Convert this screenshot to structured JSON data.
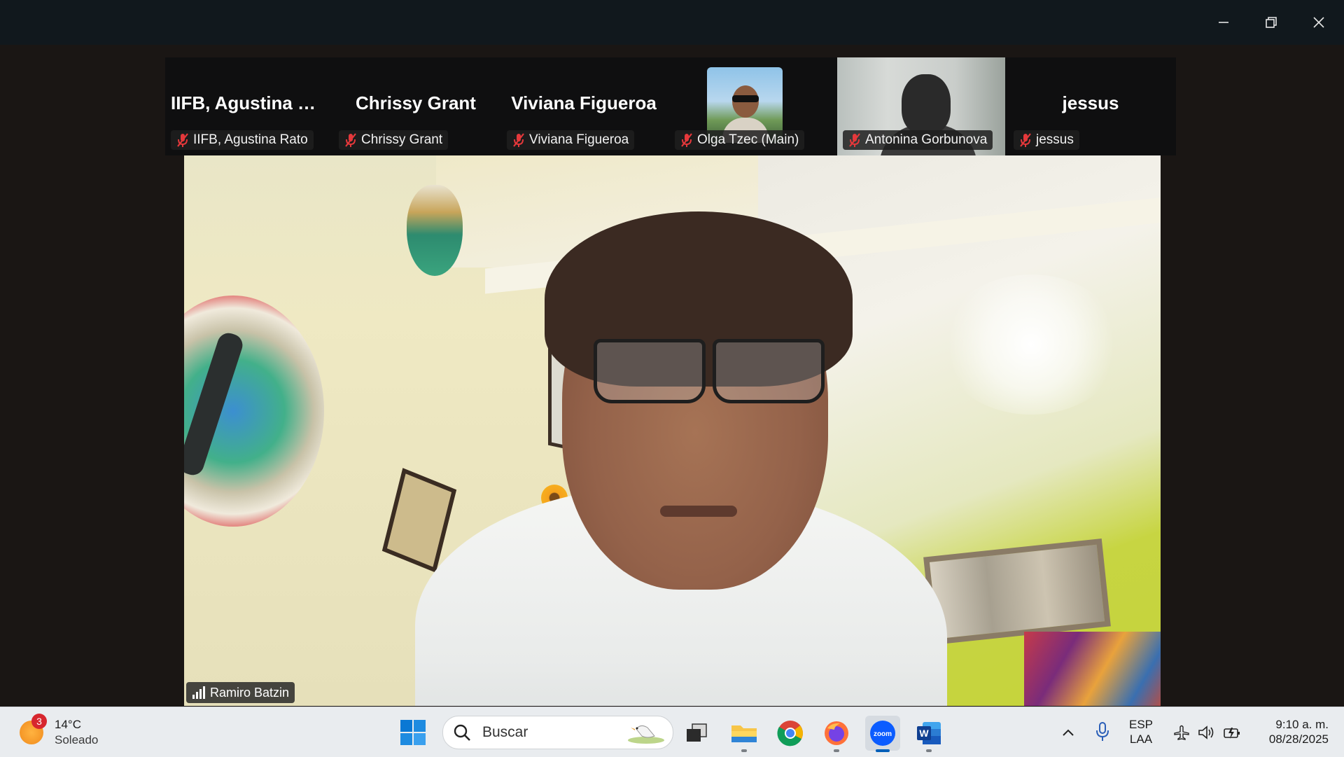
{
  "window": {
    "controls": [
      {
        "name": "minimize-button",
        "icon": "minimize-icon"
      },
      {
        "name": "restore-button",
        "icon": "restore-icon"
      },
      {
        "name": "close-button",
        "icon": "close-icon"
      }
    ]
  },
  "participants": [
    {
      "big_name": "IIFB, Agustina R...",
      "tag": "IIFB, Agustina Rato",
      "muted": true,
      "display": "name"
    },
    {
      "big_name": "Chrissy Grant",
      "tag": "Chrissy Grant",
      "muted": true,
      "display": "name"
    },
    {
      "big_name": "Viviana Figueroa",
      "tag": "Viviana Figueroa",
      "muted": true,
      "display": "name"
    },
    {
      "big_name": "",
      "tag": "Olga Tzec (Main)",
      "muted": true,
      "display": "photo"
    },
    {
      "big_name": "",
      "tag": "Antonina Gorbunova",
      "muted": true,
      "display": "video"
    },
    {
      "big_name": "jessus",
      "tag": "jessus",
      "muted": true,
      "display": "name"
    }
  ],
  "active_speaker": {
    "name": "Ramiro Batzin",
    "signal_icon": "signal-bars-icon"
  },
  "taskbar": {
    "weather": {
      "badge": "3",
      "temp": "14°C",
      "condition": "Soleado"
    },
    "search": {
      "placeholder": "Buscar"
    },
    "apps": [
      {
        "name": "start",
        "icon": "windows-logo-icon"
      },
      {
        "name": "task-view",
        "icon": "task-view-icon"
      },
      {
        "name": "file-explorer",
        "icon": "folder-icon"
      },
      {
        "name": "chrome",
        "icon": "chrome-icon"
      },
      {
        "name": "firefox",
        "icon": "firefox-icon"
      },
      {
        "name": "zoom",
        "icon": "zoom-icon",
        "label": "zoom",
        "active": true
      },
      {
        "name": "word",
        "icon": "word-icon",
        "label": "W"
      }
    ],
    "tray": {
      "language_top": "ESP",
      "language_bottom": "LAA",
      "time": "9:10 a. m.",
      "date": "08/28/2025"
    }
  },
  "colors": {
    "titlebar": "#11181d",
    "strip": "#0f0f10",
    "muted_red": "#e5383b",
    "taskbar": "#e9ecef",
    "zoom_blue": "#0b5cff",
    "accent": "#005fb8"
  }
}
